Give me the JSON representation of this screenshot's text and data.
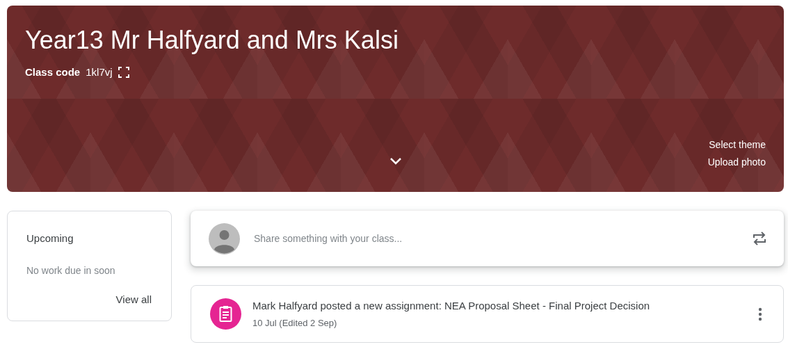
{
  "banner": {
    "title": "Year13 Mr Halfyard and Mrs Kalsi",
    "class_code_label": "Class code",
    "class_code": "1kl7vj",
    "links": [
      "Select theme",
      "Upload photo"
    ]
  },
  "upcoming": {
    "title": "Upcoming",
    "message": "No work due in soon",
    "link": "View all"
  },
  "composer": {
    "placeholder": "Share something with your class..."
  },
  "posts": [
    {
      "kind": "assignment",
      "title": "Mark Halfyard posted a new assignment: NEA Proposal Sheet - Final Project Decision",
      "date": "10 Jul (Edited 2 Sep)"
    }
  ]
}
